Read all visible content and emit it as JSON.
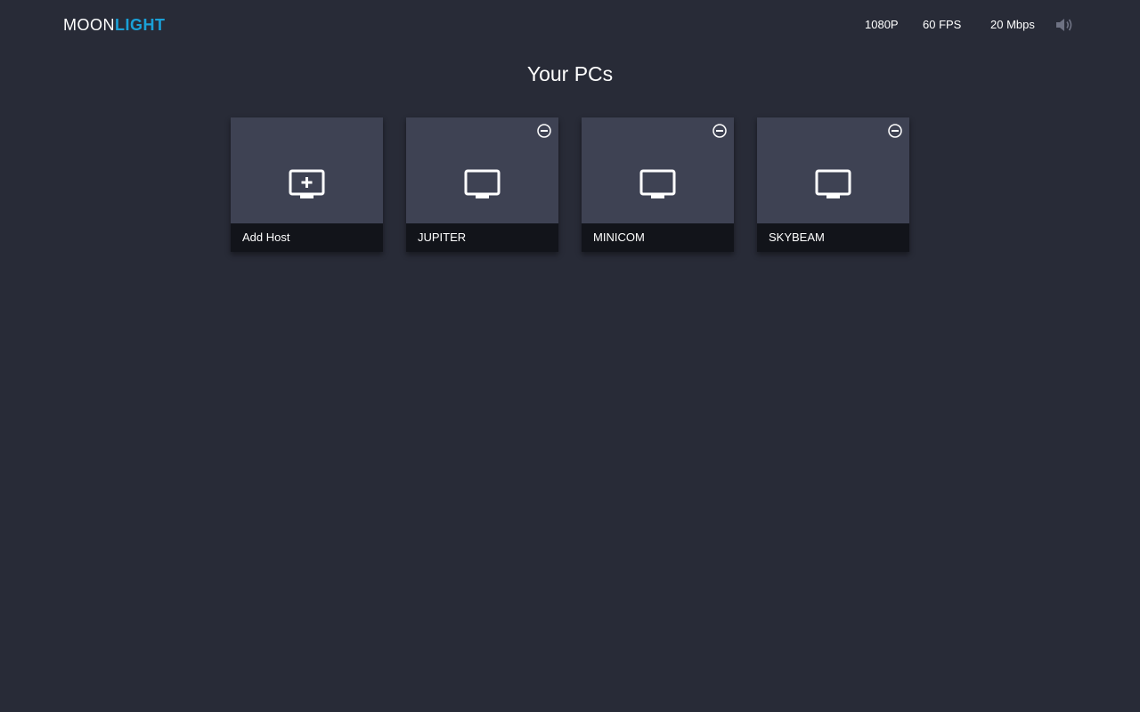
{
  "header": {
    "brand_part1": "MOON",
    "brand_part2": "LIGHT",
    "resolution": "1080P",
    "fps": "60 FPS",
    "bitrate": "20 Mbps",
    "audio_icon": "speaker-icon"
  },
  "main": {
    "title": "Your PCs",
    "tiles": [
      {
        "label": "Add Host",
        "icon": "add-monitor-icon"
      },
      {
        "label": "JUPITER",
        "icon": "monitor-icon",
        "action_icon": "remove-circle-icon"
      },
      {
        "label": "MINICOM",
        "icon": "monitor-icon",
        "action_icon": "remove-circle-icon"
      },
      {
        "label": "SKYBEAM",
        "icon": "monitor-icon",
        "action_icon": "remove-circle-icon"
      }
    ]
  },
  "colors": {
    "background": "#282b37",
    "tile": "#3e4253",
    "tile_footer": "#12141a",
    "accent": "#1aa1d8"
  }
}
